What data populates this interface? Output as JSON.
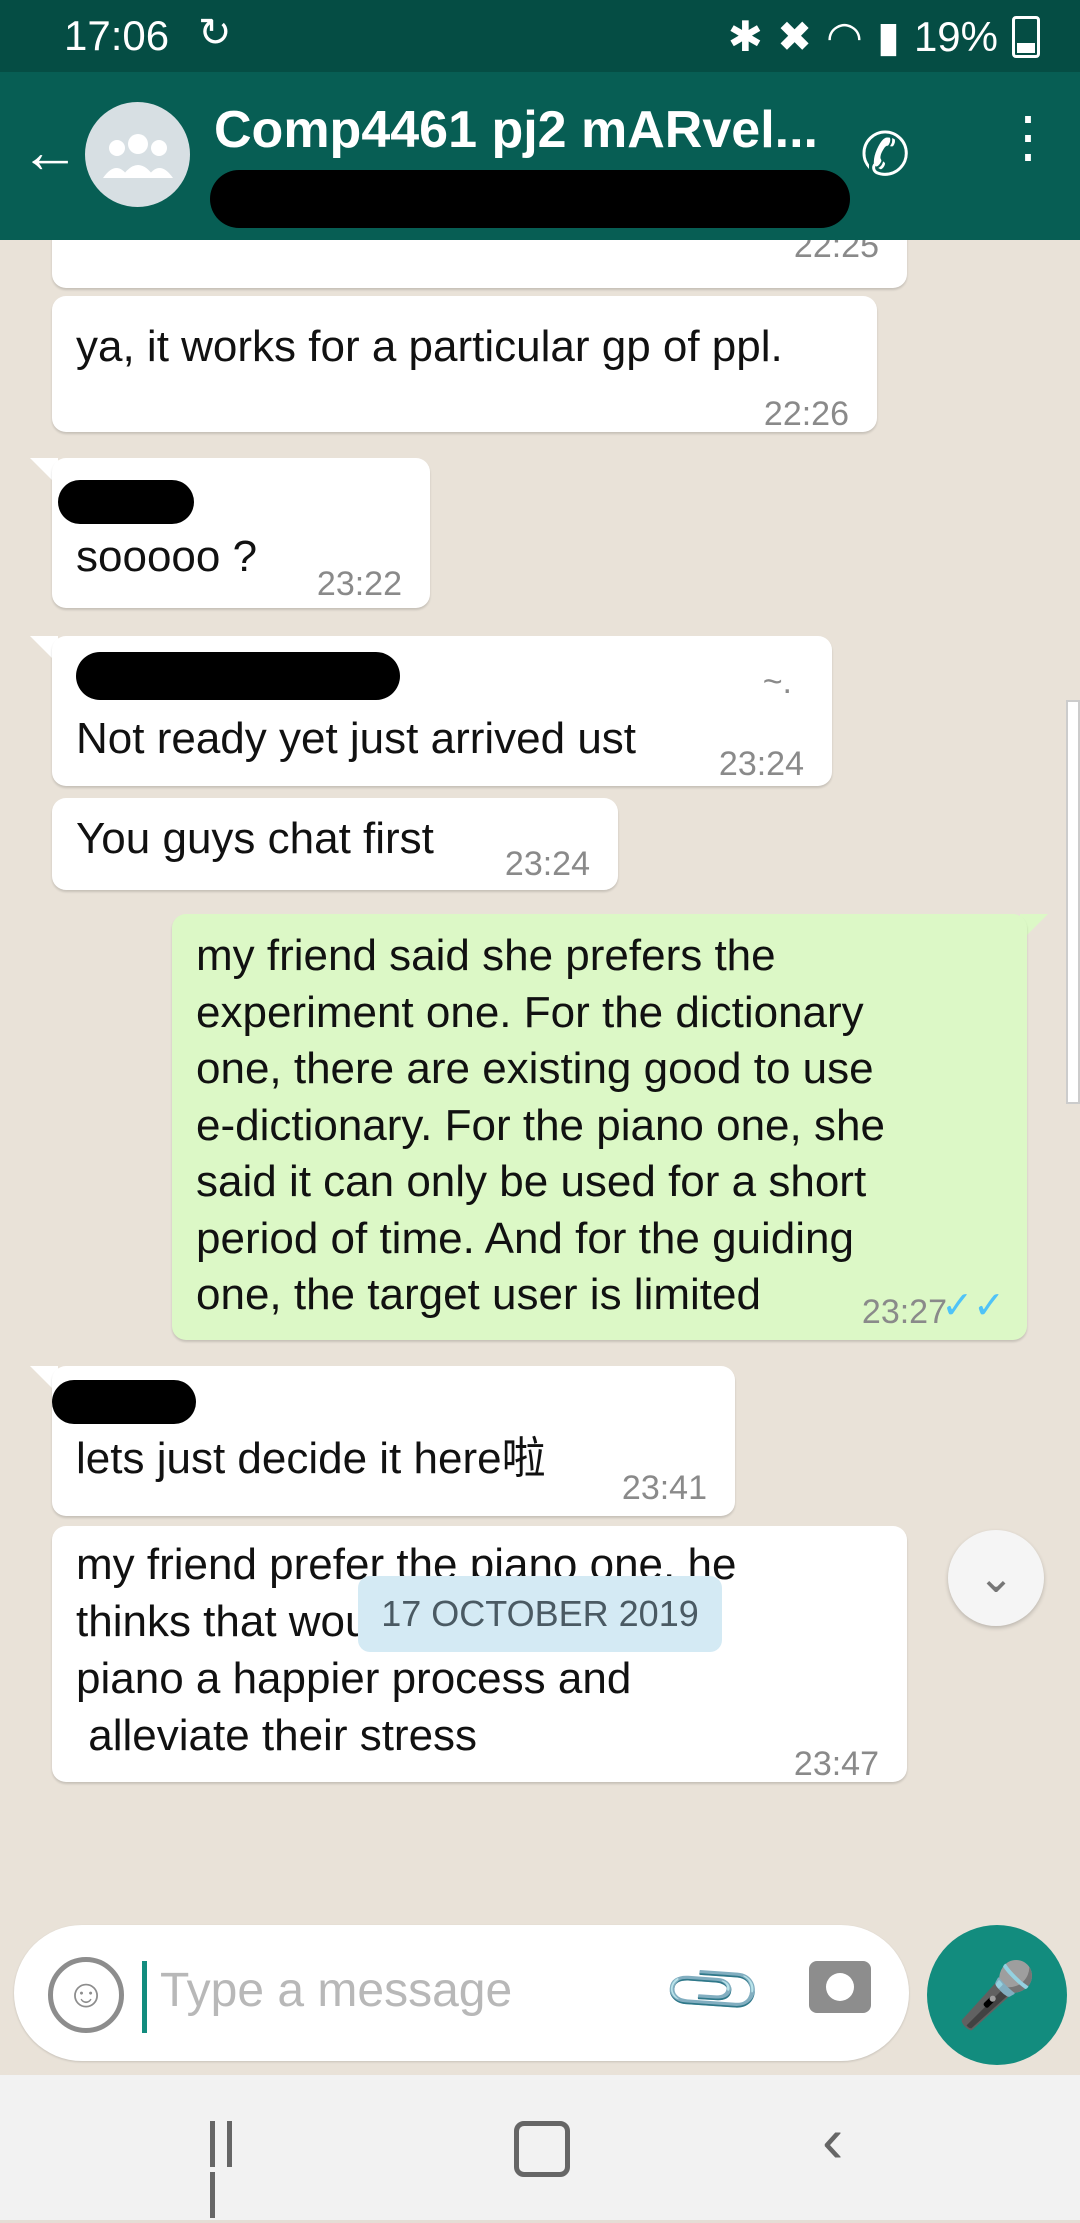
{
  "status": {
    "time": "17:06",
    "battery": "19%"
  },
  "header": {
    "group_name": "Comp4461 pj2 mARvel..."
  },
  "messages": [
    {
      "text": "",
      "time": "22:25"
    },
    {
      "text": "ya, it works for a particular gp of ppl.",
      "time": "22:26"
    },
    {
      "text": "sooooo ?",
      "time": "23:22"
    },
    {
      "text": "Not ready yet just arrived ust",
      "time": "23:24",
      "extra": "~."
    },
    {
      "text": "You guys chat first",
      "time": "23:24"
    },
    {
      "text": "my friend said she prefers the\nexperiment one. For the dictionary\none, there are existing good to use\ne-dictionary. For the piano one, she\nsaid it can only be used for a short\nperiod of time. And for the guiding\none, the target user is limited",
      "time": "23:27",
      "ticks": "✓✓"
    },
    {
      "text": "lets just decide it here啦",
      "time": "23:41"
    },
    {
      "text": "my friend prefer the piano one, he\nthinks that would make practising\npiano a happier process and\n alleviate their stress",
      "time": "23:47"
    }
  ],
  "date_chip": "17 OCTOBER 2019",
  "input": {
    "placeholder": "Type a message"
  },
  "colors": {
    "header": "#075e54",
    "outgoing_bubble": "#dcf8c6",
    "accent": "#128c7e"
  }
}
